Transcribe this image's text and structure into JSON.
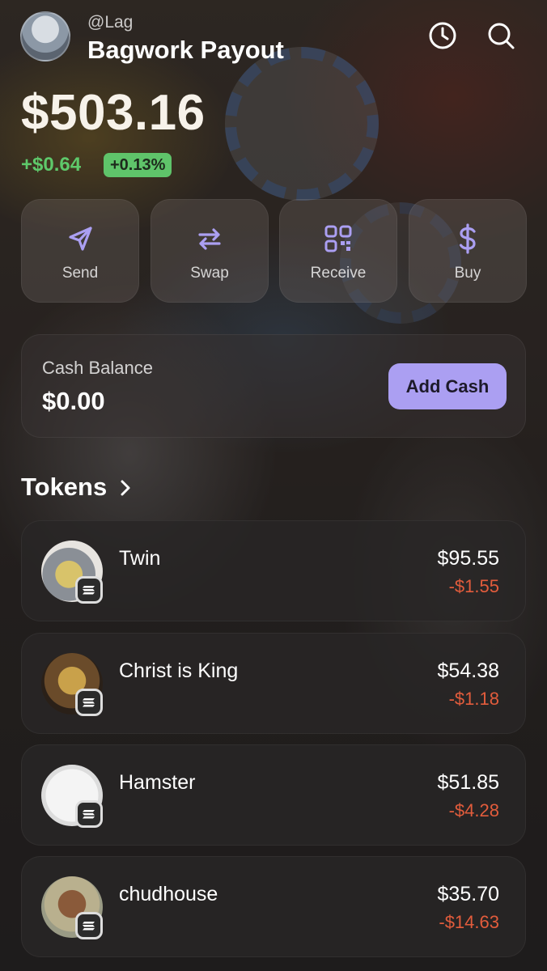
{
  "header": {
    "handle": "@Lag",
    "wallet_name": "Bagwork Payout",
    "history_icon": "clock-icon",
    "search_icon": "search-icon"
  },
  "portfolio": {
    "balance": "$503.16",
    "change_amount": "+$0.64",
    "change_percent": "+0.13%"
  },
  "actions": [
    {
      "label": "Send",
      "icon": "send-icon"
    },
    {
      "label": "Swap",
      "icon": "swap-icon"
    },
    {
      "label": "Receive",
      "icon": "qr-code-icon"
    },
    {
      "label": "Buy",
      "icon": "dollar-icon"
    }
  ],
  "cash": {
    "label": "Cash Balance",
    "value": "$0.00",
    "button_label": "Add Cash"
  },
  "tokens_section": {
    "title": "Tokens"
  },
  "tokens": [
    {
      "name": "Twin",
      "value": "$95.55",
      "change": "-$1.55"
    },
    {
      "name": "Christ is King",
      "value": "$54.38",
      "change": "-$1.18"
    },
    {
      "name": "Hamster",
      "value": "$51.85",
      "change": "-$4.28"
    },
    {
      "name": "chudhouse",
      "value": "$35.70",
      "change": "-$14.63"
    }
  ],
  "colors": {
    "accent": "#ab9ff2",
    "positive": "#5ec86a",
    "negative": "#e25c3c"
  }
}
